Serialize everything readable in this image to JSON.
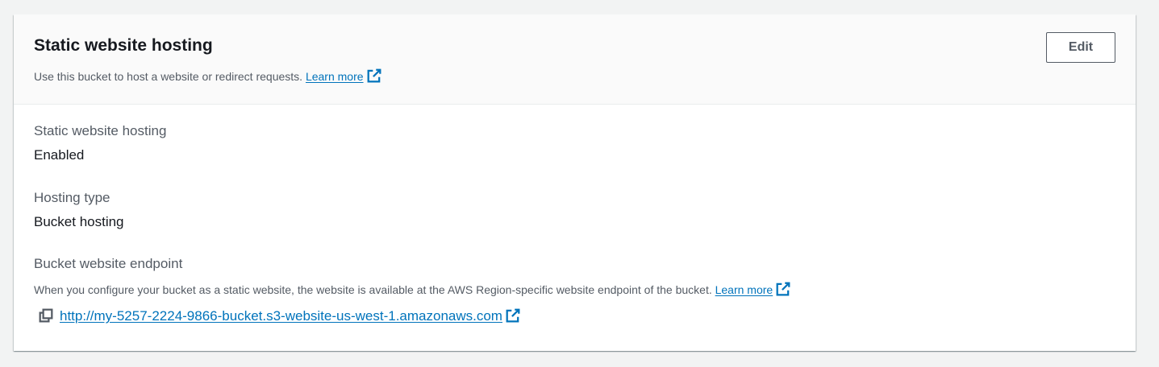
{
  "panel": {
    "title": "Static website hosting",
    "description": "Use this bucket to host a website or redirect requests.",
    "learn_more_label": "Learn more",
    "edit_label": "Edit"
  },
  "fields": {
    "hosting": {
      "label": "Static website hosting",
      "value": "Enabled"
    },
    "hosting_type": {
      "label": "Hosting type",
      "value": "Bucket hosting"
    },
    "endpoint": {
      "label": "Bucket website endpoint",
      "description": "When you configure your bucket as a static website, the website is available at the AWS Region-specific website endpoint of the bucket.",
      "learn_more_label": "Learn more",
      "url": "http://my-5257-2224-9866-bucket.s3-website-us-west-1.amazonaws.com"
    }
  },
  "icons": {
    "external_link": "external-link-icon",
    "copy": "copy-icon"
  },
  "colors": {
    "link": "#0073bb",
    "label": "#545b64",
    "value": "#16191f",
    "header_bg": "#fafafa",
    "page_bg": "#f2f3f3"
  }
}
